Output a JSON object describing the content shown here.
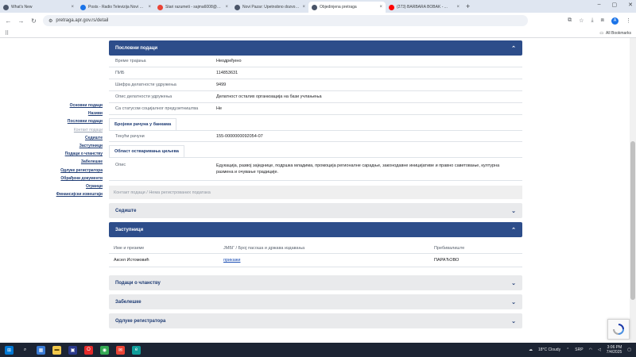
{
  "browser": {
    "tabs": [
      {
        "title": "What's New",
        "color": "#4a5568",
        "active": false
      },
      {
        "title": "Posts - Radio Televizija Novi Pazar",
        "color": "#1a73e8",
        "active": false
      },
      {
        "title": "Stari razumeti - sajma6008@gmail",
        "color": "#ea4335",
        "active": false
      },
      {
        "title": "Novi Pazar: Upetnobno dozvoli...",
        "color": "#4a5568",
        "active": false
      },
      {
        "title": "Objedinjena pretraga",
        "color": "#4a5568",
        "active": true
      },
      {
        "title": "(273) BARBARA BOBAK - ...",
        "color": "#ff0000",
        "active": false
      }
    ],
    "new_tab": "+",
    "url": "pretraga.apr.gov.rs/detail",
    "all_bookmarks": "All Bookmarks",
    "avatar_letter": "A"
  },
  "sidenav": [
    {
      "label": "Основни подаци",
      "muted": false
    },
    {
      "label": "Називи",
      "muted": false
    },
    {
      "label": "Пословни подаци",
      "muted": false
    },
    {
      "label": "Контакт подаци",
      "muted": true
    },
    {
      "label": "Седиште",
      "muted": false
    },
    {
      "label": "Заступници",
      "muted": false
    },
    {
      "label": "Подаци о чланству",
      "muted": false
    },
    {
      "label": "Забелешке",
      "muted": false
    },
    {
      "label": "Одлуке регистратора",
      "muted": false
    },
    {
      "label": "Обрађени документи",
      "muted": false
    },
    {
      "label": "Огранци",
      "muted": false
    },
    {
      "label": "Финансијски извештаји",
      "muted": false
    }
  ],
  "business": {
    "title": "Пословни подаци",
    "rows": [
      {
        "k": "Време трајања",
        "v": "Неодређено"
      },
      {
        "k": "ПИБ",
        "v": "114853631"
      },
      {
        "k": "Шифра делатности удружења",
        "v": "9499"
      },
      {
        "k": "Опис делатности удружења",
        "v": "Делатност осталих организација на бази учлањења"
      },
      {
        "k": "Са статусом социјалног предузетништва",
        "v": "Не"
      }
    ],
    "bank_tab": "Бројеви рачуна у банкама",
    "bank_row": {
      "k": "Текући рачуни",
      "v": "155-0000000092054-07"
    },
    "goals_tab": "Област остваривања циљева",
    "goals_row": {
      "k": "Опис",
      "v": "Едукација, развој заједнице, подршка младима, промоција регионалне сарадње, законодавне иницијативе и правно саветовање, културна размена и очување традиције."
    }
  },
  "breadcrumb": "Контакт подаци / Нема регистрованих података",
  "seat": {
    "title": "Седиште"
  },
  "reps": {
    "title": "Заступници",
    "headers": [
      "Име и презиме",
      "ЈМБГ / Број пасоша и држава издавања",
      "Пребивалиште"
    ],
    "rows": [
      {
        "name": "Аксел Истомовић",
        "id": "прикажи",
        "place": "ПАРАЋОВО"
      }
    ]
  },
  "membership": {
    "title": "Подаци о чланству"
  },
  "notes": {
    "title": "Забелешке"
  },
  "decisions": {
    "title": "Одлуке регистратора"
  },
  "taskbar": {
    "weather": "18°C Cloudy",
    "lang": "SRP",
    "time": "3:06 PM",
    "date": "7/4/2025"
  }
}
